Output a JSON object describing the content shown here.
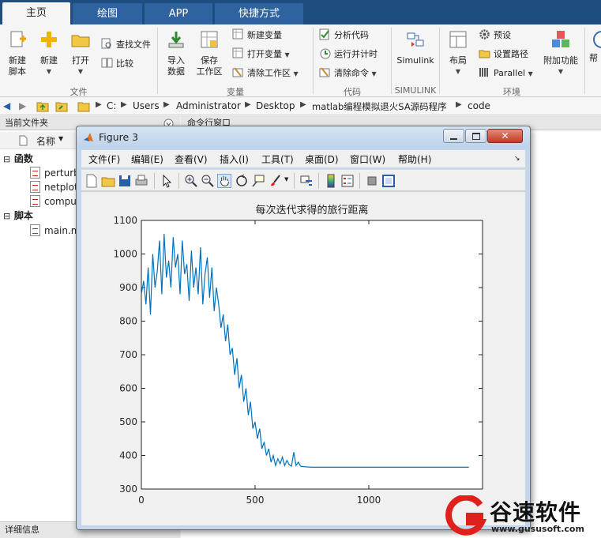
{
  "ribbon_tabs": [
    "主页",
    "绘图",
    "APP",
    "快捷方式"
  ],
  "ribbon": {
    "file_group": {
      "new_script": "新建\n脚本",
      "new": "新建",
      "open": "打开",
      "find_files": "查找文件",
      "compare": "比较",
      "label": "文件"
    },
    "variable_group": {
      "import_data": "导入\n数据",
      "save_workspace": "保存\n工作区",
      "new_variable": "新建变量",
      "open_variable": "打开变量",
      "clear_workspace": "清除工作区",
      "label": "变量"
    },
    "code_group": {
      "analyze_code": "分析代码",
      "run_and_time": "运行并计时",
      "clear_commands": "清除命令",
      "label": "代码"
    },
    "simulink_group": {
      "simulink": "Simulink",
      "label": "SIMULINK"
    },
    "environment_group": {
      "layout": "布局",
      "preferences": "预设",
      "set_path": "设置路径",
      "parallel": "Parallel",
      "addons": "附加功能",
      "label": "环境"
    },
    "help_partial": "帮"
  },
  "address_path": [
    "C:",
    "Users",
    "Administrator",
    "Desktop",
    "matlab编程模拟退火SA源码程序",
    "code"
  ],
  "current_folder": {
    "title": "当前文件夹",
    "name_header": "名称",
    "functions_label": "函数",
    "function_files": [
      "perturb",
      "netplot",
      "compu"
    ],
    "scripts_label": "脚本",
    "script_files": [
      "main.m"
    ],
    "details_label": "详细信息"
  },
  "command_window_title": "命令行窗口",
  "figure": {
    "title": "Figure 3",
    "menu": [
      "文件(F)",
      "编辑(E)",
      "查看(V)",
      "插入(I)",
      "工具(T)",
      "桌面(D)",
      "窗口(W)",
      "帮助(H)"
    ]
  },
  "chart_data": {
    "type": "line",
    "title": "每次迭代求得的旅行距离",
    "xlabel": "",
    "ylabel": "",
    "xlim": [
      0,
      1500
    ],
    "ylim": [
      300,
      1100
    ],
    "xticks": [
      0,
      500,
      1000
    ],
    "yticks": [
      300,
      400,
      500,
      600,
      700,
      800,
      900,
      1000,
      1100
    ],
    "series_color": "#0072bd",
    "series": [
      {
        "x": [
          0,
          10,
          20,
          30,
          40,
          50,
          60,
          70,
          80,
          90,
          100,
          110,
          120,
          130,
          140,
          150,
          160,
          170,
          180,
          190,
          200,
          210,
          220,
          230,
          240,
          250,
          260,
          270,
          280,
          290,
          300,
          310,
          320,
          330,
          340,
          350,
          360,
          370,
          380,
          390,
          400,
          410,
          420,
          430,
          440,
          450,
          460,
          470,
          480,
          490,
          500,
          510,
          520,
          530,
          540,
          550,
          560,
          570,
          580,
          590,
          600,
          610,
          620,
          630,
          640,
          650,
          660,
          670,
          680,
          690,
          700,
          720,
          750,
          800,
          900,
          1000,
          1100,
          1200,
          1300,
          1400,
          1440
        ],
        "y": [
          880,
          920,
          850,
          960,
          820,
          1000,
          900,
          950,
          1040,
          880,
          1060,
          930,
          980,
          900,
          1050,
          960,
          1000,
          880,
          1040,
          940,
          970,
          860,
          1010,
          900,
          960,
          880,
          1020,
          850,
          940,
          990,
          870,
          960,
          830,
          900,
          850,
          780,
          820,
          740,
          790,
          700,
          720,
          640,
          690,
          600,
          640,
          560,
          600,
          520,
          560,
          480,
          500,
          450,
          480,
          420,
          440,
          400,
          420,
          380,
          400,
          370,
          390,
          375,
          395,
          370,
          385,
          372,
          368,
          410,
          370,
          380,
          368,
          366,
          365,
          365,
          365,
          365,
          365,
          365,
          365,
          365,
          365
        ]
      }
    ]
  },
  "watermark": {
    "brand": "谷速软件",
    "url": "www.gususoft.com",
    "brand_color": "#e0201b"
  }
}
